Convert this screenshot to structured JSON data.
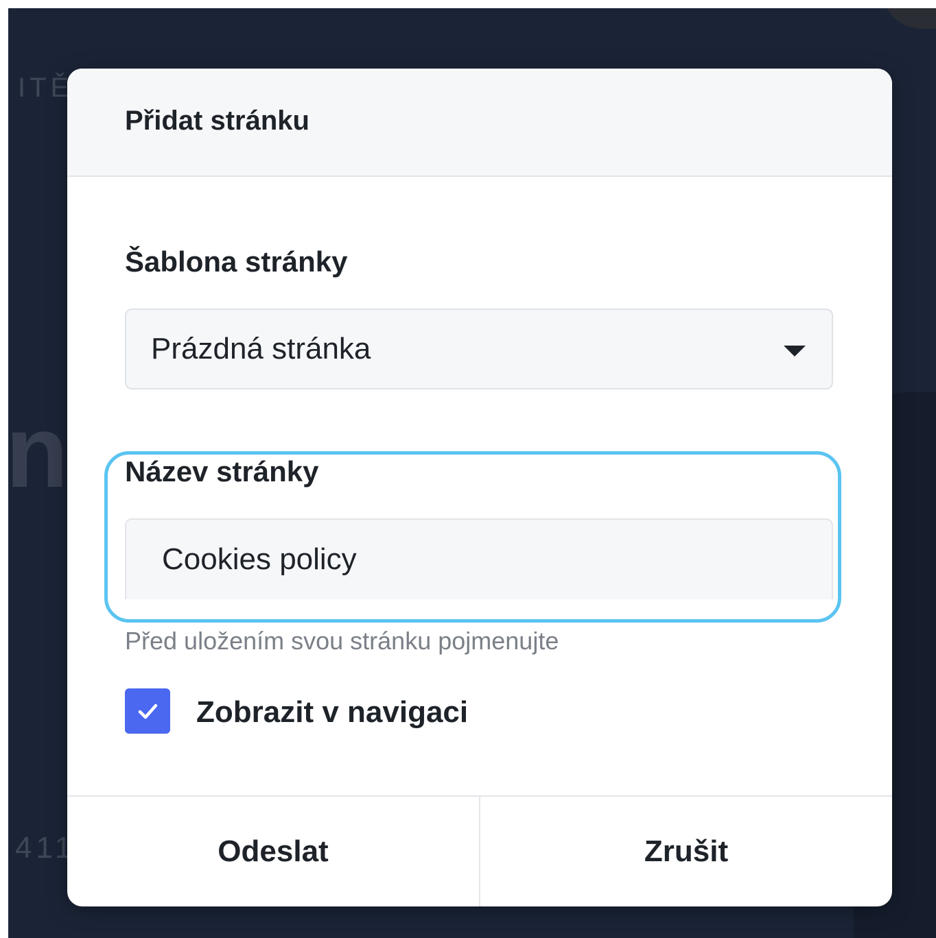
{
  "background": {
    "top_text": "ITĚ",
    "big_text": "n",
    "number_text": "411"
  },
  "dialog": {
    "title": "Přidat stránku",
    "template_field": {
      "label": "Šablona stránky",
      "selected_value": "Prázdná stránka",
      "caret_icon": "chevron-down-icon"
    },
    "name_field": {
      "label": "Název stránky",
      "value": "Cookies policy",
      "helper_text": "Před uložením svou stránku pojmenujte"
    },
    "show_in_navigation": {
      "label": "Zobrazit v navigaci",
      "checked": true
    },
    "buttons": {
      "submit_label": "Odeslat",
      "cancel_label": "Zrušit"
    }
  },
  "colors": {
    "backdrop": "#1b2437",
    "focus_ring": "#5bc4f1",
    "checkbox": "#4a68f0"
  }
}
